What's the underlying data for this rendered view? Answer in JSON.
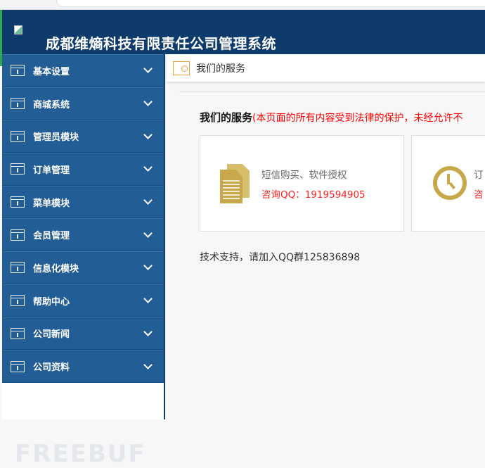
{
  "header": {
    "title": "成都维熵科技有限责任公司管理系统"
  },
  "sidebar": {
    "items": [
      {
        "label": "基本设置"
      },
      {
        "label": "商城系统"
      },
      {
        "label": "管理员模块"
      },
      {
        "label": "订单管理"
      },
      {
        "label": "菜单模块"
      },
      {
        "label": "会员管理"
      },
      {
        "label": "信息化模块"
      },
      {
        "label": "帮助中心"
      },
      {
        "label": "公司新闻"
      },
      {
        "label": "公司资料"
      }
    ]
  },
  "watermark": "FREEBUF",
  "tab": {
    "label": "我们的服务"
  },
  "section": {
    "title": "我们的服务",
    "notice": "(本页面的所有内容受到法律的保护，未经允许不"
  },
  "cards": [
    {
      "title": "短信购买、软件授权",
      "contact": "咨询QQ：1919594905",
      "icon": "document-icon"
    },
    {
      "title": "订",
      "contact": "咨",
      "icon": "clock-icon"
    }
  ],
  "support": "技术支持，请加入QQ群125836898",
  "colors": {
    "header": "#0e3b6c",
    "nav": "#235d96",
    "accent": "#c9a84c",
    "red": "#ff2222"
  }
}
